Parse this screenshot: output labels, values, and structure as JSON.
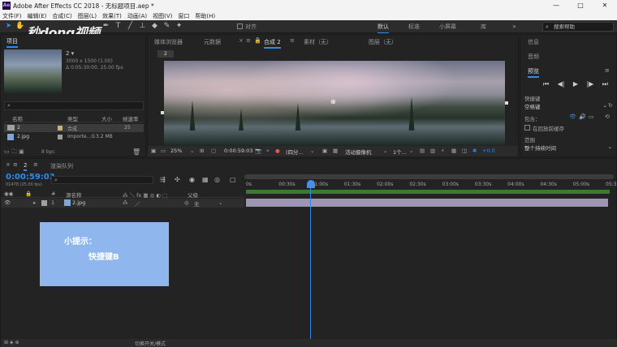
{
  "window": {
    "title": "Adobe After Effects CC 2018 - 无标题项目.aep *",
    "app_icon": "Ae",
    "min": "—",
    "max": "□",
    "close": "✕"
  },
  "menu": [
    "文件(F)",
    "编辑(E)",
    "合成(C)",
    "图层(L)",
    "效果(T)",
    "动画(A)",
    "视图(V)",
    "窗口",
    "帮助(H)"
  ],
  "toolbar": {
    "snap_label": "对齐",
    "workspaces": [
      "默认",
      "标准",
      "小屏幕",
      "库"
    ],
    "search_placeholder": "搜索帮助"
  },
  "watermark": "秒dong视频",
  "project": {
    "tab": "项目",
    "item_name": "2 ▾",
    "item_info1": "3000 x 1500 (1.00)",
    "item_info2": "Δ 0:05:30:00, 25.00 fps",
    "search_icon": "search-icon",
    "columns": [
      "名称",
      "类型",
      "大小",
      "帧速率"
    ],
    "rows": [
      {
        "name": "2",
        "type": "合成",
        "size": "",
        "fps": "25"
      },
      {
        "name": "2.jpg",
        "type": "Importe...G",
        "size": "3.2 MB",
        "fps": ""
      }
    ],
    "bpc": "8 bpc"
  },
  "viewer": {
    "tabs": [
      "媒体浏览器",
      "元数据",
      "合成 2",
      "素材（无）",
      "图层（无）"
    ],
    "active_tab": "合成 2",
    "comp_label": "2",
    "zoom": "25%",
    "timecode": "0:00:59:03",
    "resolution": "(四分...",
    "camera": "活动摄像机",
    "views": "1个...",
    "offset": "+0.0"
  },
  "right_panel": {
    "info": "信息",
    "audio": "音频",
    "preview": "预览",
    "shortcut_label": "快捷键",
    "shortcut_value": "空格键",
    "include_label": "包含：",
    "cache_label": "在回放前缓存",
    "range_label": "范围",
    "range_value": "整个持续时间",
    "transport": [
      "⏮",
      "◀|",
      "▶",
      "|▶",
      "⏭"
    ]
  },
  "timeline": {
    "tab": "2",
    "render_tab": "渲染队列",
    "timecode": "0:00:59:03",
    "timecode_sub": "01478 (25.00 fps)",
    "layer_header": [
      "#",
      "源名称",
      "父级"
    ],
    "layer": {
      "index": "1",
      "name": "2.jpg",
      "parent": "无"
    },
    "ruler": [
      "0s",
      "00:30s",
      "01:00s",
      "01:30s",
      "02:00s",
      "02:30s",
      "03:00s",
      "03:30s",
      "04:00s",
      "04:30s",
      "05:00s",
      "05:3"
    ],
    "playhead_fraction": 0.18,
    "toggle_label": "切换开关/模式"
  },
  "tip": {
    "title": "小提示：",
    "text": "快捷键B"
  }
}
